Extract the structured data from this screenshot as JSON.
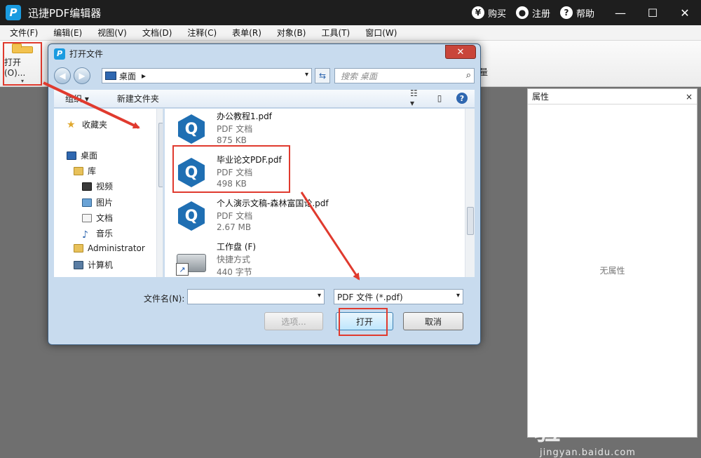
{
  "app": {
    "logo_letter": "P",
    "title": "迅捷PDF编辑器",
    "buy_icon": "¥",
    "buy": "购买",
    "register": "注册",
    "help_icon": "?",
    "help": "帮助",
    "minimize": "—",
    "maximize": "☐",
    "close": "✕"
  },
  "menu": [
    "文件(F)",
    "编辑(E)",
    "视图(V)",
    "文档(D)",
    "注释(C)",
    "表单(R)",
    "对象(B)",
    "工具(T)",
    "窗口(W)"
  ],
  "toolbar": {
    "open_label": "打开(O)...",
    "open_caret": "▾",
    "partial_label": "量"
  },
  "properties": {
    "title": "属性",
    "close": "×",
    "empty": "无属性"
  },
  "watermark": {
    "main": "Bai du 经验",
    "sub": "jingyan.baidu.com"
  },
  "dialog": {
    "logo_letter": "P",
    "title": "打开文件",
    "close": "✕",
    "back": "◀",
    "forward": "▶",
    "address": "桌面",
    "address_arrow": "▸",
    "address_caret": "▾",
    "refresh": "⇆",
    "search_placeholder": "搜索 桌面",
    "search_icon": "⌕",
    "organize": "组织 ▾",
    "new_folder": "新建文件夹",
    "view_icon": "☷ ▾",
    "preview_icon": "▯",
    "help_icon": "?",
    "nav": {
      "favorites": "收藏夹",
      "desktop": "桌面",
      "library": "库",
      "videos": "视频",
      "pictures": "图片",
      "documents": "文档",
      "music": "音乐",
      "administrator": "Administrator",
      "computer": "计算机"
    },
    "files": [
      {
        "name": "办公教程1.pdf",
        "type": "PDF 文档",
        "size": "875 KB",
        "icon": "pdf-q-icon",
        "glyph": "Q"
      },
      {
        "name": "毕业论文PDF.pdf",
        "type": "PDF 文档",
        "size": "498 KB",
        "icon": "pdf-q-icon",
        "glyph": "Q"
      },
      {
        "name": "个人演示文稿-森林富国论.pdf",
        "type": "PDF 文档",
        "size": "2.67 MB",
        "icon": "pdf-q-icon",
        "glyph": "Q"
      },
      {
        "name": "工作盘 (F)",
        "type": "快捷方式",
        "size": "440 字节",
        "icon": "drive-shortcut-icon",
        "glyph": "↗"
      }
    ],
    "filename_label": "文件名(N):",
    "filename_value": "",
    "filename_caret": "▾",
    "filetype_value": "PDF 文件 (*.pdf)",
    "filetype_caret": "▾",
    "btn_options": "选项...",
    "btn_open": "打开",
    "btn_cancel": "取消"
  },
  "colors": {
    "accent": "#1a9be0",
    "highlight": "#e03a2e",
    "dialog_frame": "#c8dbee"
  }
}
